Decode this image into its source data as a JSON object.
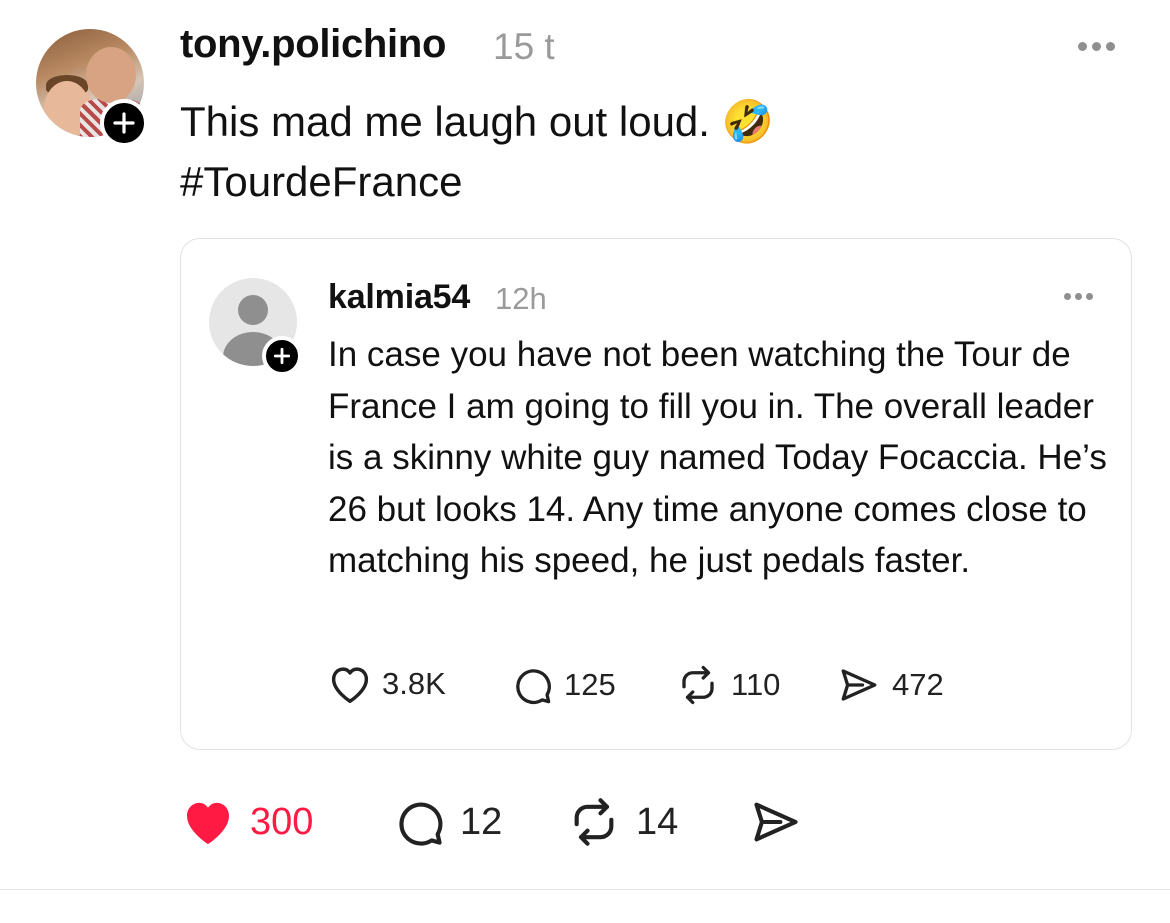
{
  "post": {
    "username": "tony.polichino",
    "timestamp": "15 t",
    "text_line1": "This mad me laugh out loud.",
    "text_line2": "#TourdeFrance",
    "emoji": "🤣",
    "likes": "300",
    "replies": "12",
    "reposts": "14",
    "liked": true,
    "like_color": "#ff1a44"
  },
  "quoted_post": {
    "username": "kalmia54",
    "timestamp": "12h",
    "text": "In case you have not been watching the Tour de France I am going to fill you in. The overall leader is a skinny white guy named Today Focaccia. He’s 26 but looks 14. Any time anyone comes close to matching his speed, he just pedals faster.",
    "likes": "3.8K",
    "replies": "125",
    "reposts": "110",
    "shares": "472"
  },
  "icons": {
    "more": "more-horizontal-icon",
    "follow": "plus-icon",
    "like": "heart-icon",
    "reply": "speech-bubble-icon",
    "repost": "repost-arrows-icon",
    "share": "paper-plane-icon"
  }
}
